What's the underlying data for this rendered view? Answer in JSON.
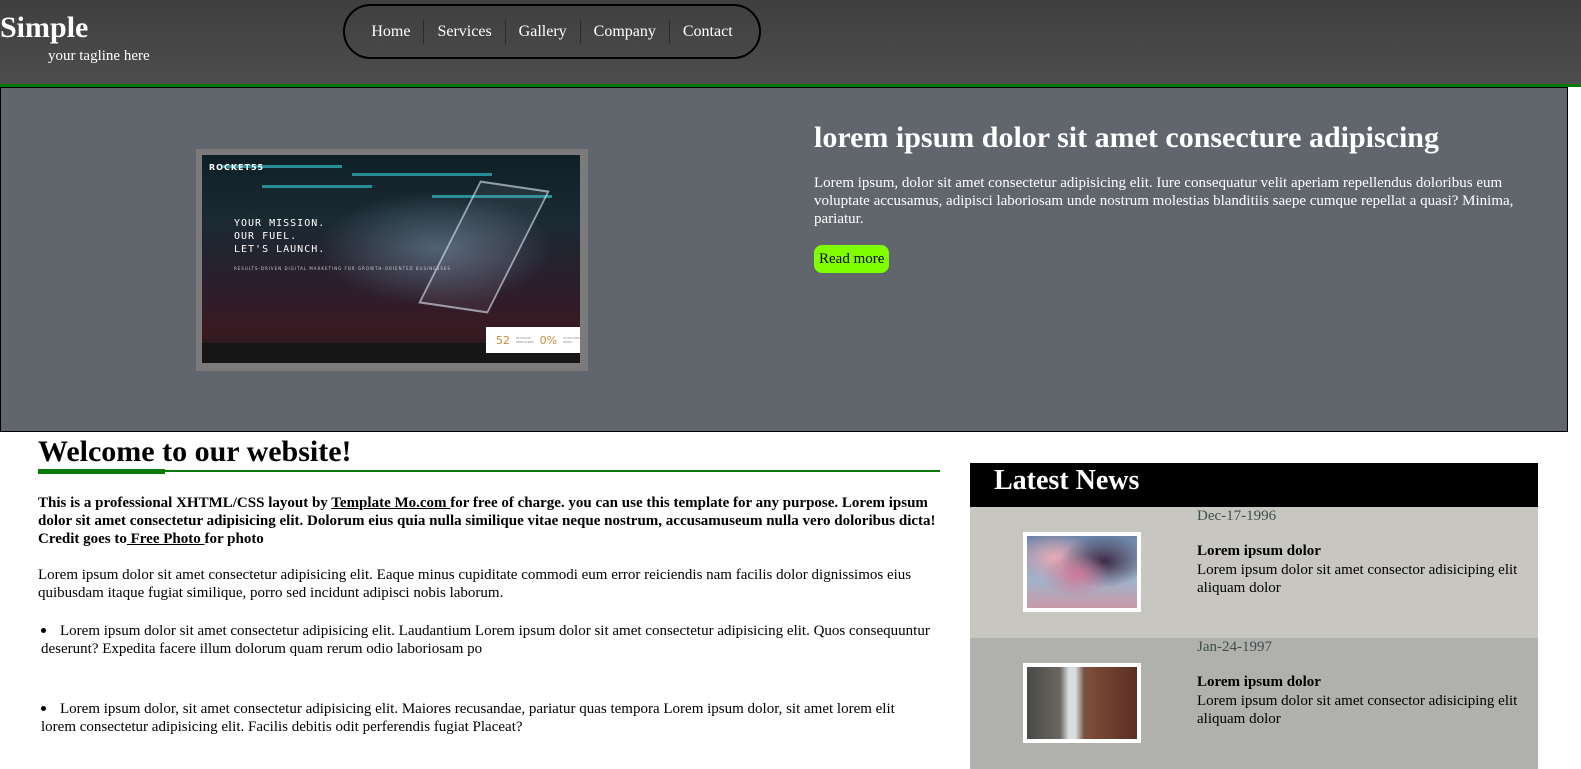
{
  "header": {
    "title": "Simple",
    "tagline": "your tagline here",
    "nav": [
      "Home",
      "Services",
      "Gallery",
      "Company",
      "Contact"
    ]
  },
  "hero": {
    "image": {
      "brand": "ROCKET55",
      "headline_lines": [
        "YOUR MISSION.",
        "OUR FUEL.",
        "LET'S LAUNCH."
      ],
      "subline": "RESULTS-DRIVEN DIGITAL MARKETING FOR GROWTH-ORIENTED BUSINESSES",
      "stat_value": "52",
      "stat_label": "IN-HOUSE EMPLOYEES",
      "stat2_value": "0%",
      "stat2_label": "OUTSOURCED WORK"
    },
    "title": "lorem ipsum dolor sit amet consecture adipiscing",
    "text": "Lorem ipsum, dolor sit amet consectetur adipisicing elit. Iure consequatur velit aperiam repellendus doloribus eum voluptate accusamus, adipisci laboriosam unde nostrum molestias blanditiis saepe cumque repellat a quasi? Minima, pariatur.",
    "button": "Read more"
  },
  "main": {
    "heading": "Welcome to our website!",
    "intro_before": "This is a professional XHTML/CSS layout by ",
    "intro_link1": "Template Mo.com ",
    "intro_middle": "for free of charge. you can use this template for any purpose. Lorem ipsum dolor sit amet consectetur adipisicing elit. Dolorum eius quia nulla similique vitae neque nostrum, accusamuseum nulla vero doloribus dicta! Credit goes to",
    "intro_link2": " Free Photo ",
    "intro_after": "for photo",
    "paragraph": "Lorem ipsum dolor sit amet consectetur adipisicing elit. Eaque minus cupiditate commodi eum error reiciendis nam facilis dolor dignissimos eius quibusdam itaque fugiat similique, porro sed incidunt adipisci nobis laborum.",
    "bullets": [
      "Lorem ipsum dolor sit amet consectetur adipisicing elit. Laudantium Lorem ipsum dolor sit amet consectetur adipisicing elit. Quos consequuntur deserunt? Expedita facere illum dolorum quam rerum odio laboriosam po",
      "Lorem ipsum dolor, sit amet consectetur adipisicing elit. Maiores recusandae, pariatur quas tempora Lorem ipsum dolor, sit amet lorem elit lorem consectetur adipisicing elit. Facilis debitis odit perferendis fugiat Placeat?"
    ]
  },
  "news": {
    "heading": "Latest News",
    "items": [
      {
        "date": "Dec-17-1996",
        "title": "Lorem ipsum dolor",
        "text": "Lorem ipsum dolor sit amet consector adisiciping elit aliquam dolor"
      },
      {
        "date": "Jan-24-1997",
        "title": "Lorem ipsum dolor",
        "text": "Lorem ipsum dolor sit amet consector adisiciping elit aliquam dolor"
      }
    ]
  }
}
